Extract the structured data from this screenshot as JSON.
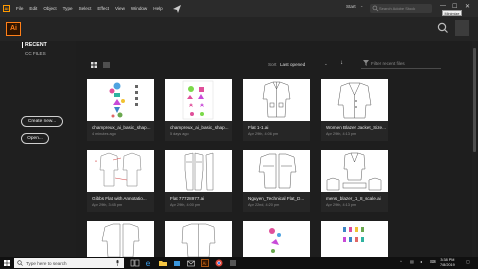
{
  "menubar": {
    "logo_text": "Ai",
    "items": [
      "File",
      "Edit",
      "Object",
      "Type",
      "Select",
      "Effect",
      "View",
      "Window",
      "Help"
    ],
    "workspace": "Start",
    "stock_search_placeholder": "Search Adobe Stock",
    "minimize_tooltip": "Minimize"
  },
  "appbar": {
    "logo_text": "Ai"
  },
  "sidebar": {
    "recent": "RECENT",
    "cc_files": "CC FILES",
    "create_new": "Create new...",
    "open": "Open..."
  },
  "toolbar": {
    "sort_label": "Sort",
    "sort_value": "Last opened",
    "filter_placeholder": "Filter recent files"
  },
  "files": [
    {
      "name": "champreux_ai_basic_shap...",
      "date": "4 minutes ago"
    },
    {
      "name": "champreux_ai_basic_shap...",
      "date": "5 days ago"
    },
    {
      "name": "Flat 1-1.ai",
      "date": "Apr 29th, 4:06 pm"
    },
    {
      "name": "Women Blazer Jacket_Size...",
      "date": "Apr 29th, 4:13 pm"
    },
    {
      "name": "Gibbs Flat with Annotatio...",
      "date": "Apr 29th, 3:45 pm"
    },
    {
      "name": "Flat 77728977.ai",
      "date": "Apr 29th, 4:00 pm"
    },
    {
      "name": "Nguyen_Technical Flat_D...",
      "date": "Apr 22nd, 4:20 pm"
    },
    {
      "name": "mens_blazer_1_8_scale.ai",
      "date": "Apr 29th, 4:13 pm"
    }
  ],
  "taskbar": {
    "search_placeholder": "Type here to search",
    "time": "3:38 PM",
    "date": "7/8/2019"
  },
  "colors": {
    "accent": "#ff7f18",
    "background": "#1e1e1e",
    "card": "#262626"
  }
}
